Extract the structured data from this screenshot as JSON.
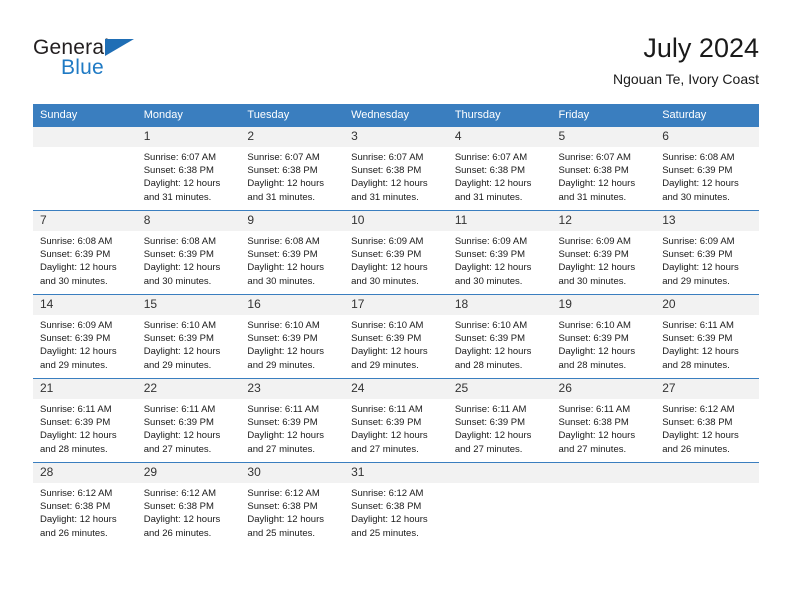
{
  "brand": {
    "name_part1": "General",
    "name_part2": "Blue",
    "triangle_color": "#1f6eb5",
    "blue_color": "#1f7ac4"
  },
  "header": {
    "title": "July 2024",
    "subtitle": "Ngouan Te, Ivory Coast"
  },
  "theme": {
    "header_bg": "#3a7ebf",
    "daynum_bg": "#f2f2f2",
    "text_color": "#1a1a1a"
  },
  "calendar": {
    "weekday_headers": [
      "Sunday",
      "Monday",
      "Tuesday",
      "Wednesday",
      "Thursday",
      "Friday",
      "Saturday"
    ],
    "weeks": [
      [
        {
          "day": "",
          "blank": true,
          "sunrise": "",
          "sunset": "",
          "daylight1": "",
          "daylight2": ""
        },
        {
          "day": "1",
          "sunrise": "Sunrise: 6:07 AM",
          "sunset": "Sunset: 6:38 PM",
          "daylight1": "Daylight: 12 hours",
          "daylight2": "and 31 minutes."
        },
        {
          "day": "2",
          "sunrise": "Sunrise: 6:07 AM",
          "sunset": "Sunset: 6:38 PM",
          "daylight1": "Daylight: 12 hours",
          "daylight2": "and 31 minutes."
        },
        {
          "day": "3",
          "sunrise": "Sunrise: 6:07 AM",
          "sunset": "Sunset: 6:38 PM",
          "daylight1": "Daylight: 12 hours",
          "daylight2": "and 31 minutes."
        },
        {
          "day": "4",
          "sunrise": "Sunrise: 6:07 AM",
          "sunset": "Sunset: 6:38 PM",
          "daylight1": "Daylight: 12 hours",
          "daylight2": "and 31 minutes."
        },
        {
          "day": "5",
          "sunrise": "Sunrise: 6:07 AM",
          "sunset": "Sunset: 6:38 PM",
          "daylight1": "Daylight: 12 hours",
          "daylight2": "and 31 minutes."
        },
        {
          "day": "6",
          "sunrise": "Sunrise: 6:08 AM",
          "sunset": "Sunset: 6:39 PM",
          "daylight1": "Daylight: 12 hours",
          "daylight2": "and 30 minutes."
        }
      ],
      [
        {
          "day": "7",
          "sunrise": "Sunrise: 6:08 AM",
          "sunset": "Sunset: 6:39 PM",
          "daylight1": "Daylight: 12 hours",
          "daylight2": "and 30 minutes."
        },
        {
          "day": "8",
          "sunrise": "Sunrise: 6:08 AM",
          "sunset": "Sunset: 6:39 PM",
          "daylight1": "Daylight: 12 hours",
          "daylight2": "and 30 minutes."
        },
        {
          "day": "9",
          "sunrise": "Sunrise: 6:08 AM",
          "sunset": "Sunset: 6:39 PM",
          "daylight1": "Daylight: 12 hours",
          "daylight2": "and 30 minutes."
        },
        {
          "day": "10",
          "sunrise": "Sunrise: 6:09 AM",
          "sunset": "Sunset: 6:39 PM",
          "daylight1": "Daylight: 12 hours",
          "daylight2": "and 30 minutes."
        },
        {
          "day": "11",
          "sunrise": "Sunrise: 6:09 AM",
          "sunset": "Sunset: 6:39 PM",
          "daylight1": "Daylight: 12 hours",
          "daylight2": "and 30 minutes."
        },
        {
          "day": "12",
          "sunrise": "Sunrise: 6:09 AM",
          "sunset": "Sunset: 6:39 PM",
          "daylight1": "Daylight: 12 hours",
          "daylight2": "and 30 minutes."
        },
        {
          "day": "13",
          "sunrise": "Sunrise: 6:09 AM",
          "sunset": "Sunset: 6:39 PM",
          "daylight1": "Daylight: 12 hours",
          "daylight2": "and 29 minutes."
        }
      ],
      [
        {
          "day": "14",
          "sunrise": "Sunrise: 6:09 AM",
          "sunset": "Sunset: 6:39 PM",
          "daylight1": "Daylight: 12 hours",
          "daylight2": "and 29 minutes."
        },
        {
          "day": "15",
          "sunrise": "Sunrise: 6:10 AM",
          "sunset": "Sunset: 6:39 PM",
          "daylight1": "Daylight: 12 hours",
          "daylight2": "and 29 minutes."
        },
        {
          "day": "16",
          "sunrise": "Sunrise: 6:10 AM",
          "sunset": "Sunset: 6:39 PM",
          "daylight1": "Daylight: 12 hours",
          "daylight2": "and 29 minutes."
        },
        {
          "day": "17",
          "sunrise": "Sunrise: 6:10 AM",
          "sunset": "Sunset: 6:39 PM",
          "daylight1": "Daylight: 12 hours",
          "daylight2": "and 29 minutes."
        },
        {
          "day": "18",
          "sunrise": "Sunrise: 6:10 AM",
          "sunset": "Sunset: 6:39 PM",
          "daylight1": "Daylight: 12 hours",
          "daylight2": "and 28 minutes."
        },
        {
          "day": "19",
          "sunrise": "Sunrise: 6:10 AM",
          "sunset": "Sunset: 6:39 PM",
          "daylight1": "Daylight: 12 hours",
          "daylight2": "and 28 minutes."
        },
        {
          "day": "20",
          "sunrise": "Sunrise: 6:11 AM",
          "sunset": "Sunset: 6:39 PM",
          "daylight1": "Daylight: 12 hours",
          "daylight2": "and 28 minutes."
        }
      ],
      [
        {
          "day": "21",
          "sunrise": "Sunrise: 6:11 AM",
          "sunset": "Sunset: 6:39 PM",
          "daylight1": "Daylight: 12 hours",
          "daylight2": "and 28 minutes."
        },
        {
          "day": "22",
          "sunrise": "Sunrise: 6:11 AM",
          "sunset": "Sunset: 6:39 PM",
          "daylight1": "Daylight: 12 hours",
          "daylight2": "and 27 minutes."
        },
        {
          "day": "23",
          "sunrise": "Sunrise: 6:11 AM",
          "sunset": "Sunset: 6:39 PM",
          "daylight1": "Daylight: 12 hours",
          "daylight2": "and 27 minutes."
        },
        {
          "day": "24",
          "sunrise": "Sunrise: 6:11 AM",
          "sunset": "Sunset: 6:39 PM",
          "daylight1": "Daylight: 12 hours",
          "daylight2": "and 27 minutes."
        },
        {
          "day": "25",
          "sunrise": "Sunrise: 6:11 AM",
          "sunset": "Sunset: 6:39 PM",
          "daylight1": "Daylight: 12 hours",
          "daylight2": "and 27 minutes."
        },
        {
          "day": "26",
          "sunrise": "Sunrise: 6:11 AM",
          "sunset": "Sunset: 6:38 PM",
          "daylight1": "Daylight: 12 hours",
          "daylight2": "and 27 minutes."
        },
        {
          "day": "27",
          "sunrise": "Sunrise: 6:12 AM",
          "sunset": "Sunset: 6:38 PM",
          "daylight1": "Daylight: 12 hours",
          "daylight2": "and 26 minutes."
        }
      ],
      [
        {
          "day": "28",
          "sunrise": "Sunrise: 6:12 AM",
          "sunset": "Sunset: 6:38 PM",
          "daylight1": "Daylight: 12 hours",
          "daylight2": "and 26 minutes."
        },
        {
          "day": "29",
          "sunrise": "Sunrise: 6:12 AM",
          "sunset": "Sunset: 6:38 PM",
          "daylight1": "Daylight: 12 hours",
          "daylight2": "and 26 minutes."
        },
        {
          "day": "30",
          "sunrise": "Sunrise: 6:12 AM",
          "sunset": "Sunset: 6:38 PM",
          "daylight1": "Daylight: 12 hours",
          "daylight2": "and 25 minutes."
        },
        {
          "day": "31",
          "sunrise": "Sunrise: 6:12 AM",
          "sunset": "Sunset: 6:38 PM",
          "daylight1": "Daylight: 12 hours",
          "daylight2": "and 25 minutes."
        },
        {
          "day": "",
          "blank": true,
          "sunrise": "",
          "sunset": "",
          "daylight1": "",
          "daylight2": ""
        },
        {
          "day": "",
          "blank": true,
          "sunrise": "",
          "sunset": "",
          "daylight1": "",
          "daylight2": ""
        },
        {
          "day": "",
          "blank": true,
          "sunrise": "",
          "sunset": "",
          "daylight1": "",
          "daylight2": ""
        }
      ]
    ]
  }
}
